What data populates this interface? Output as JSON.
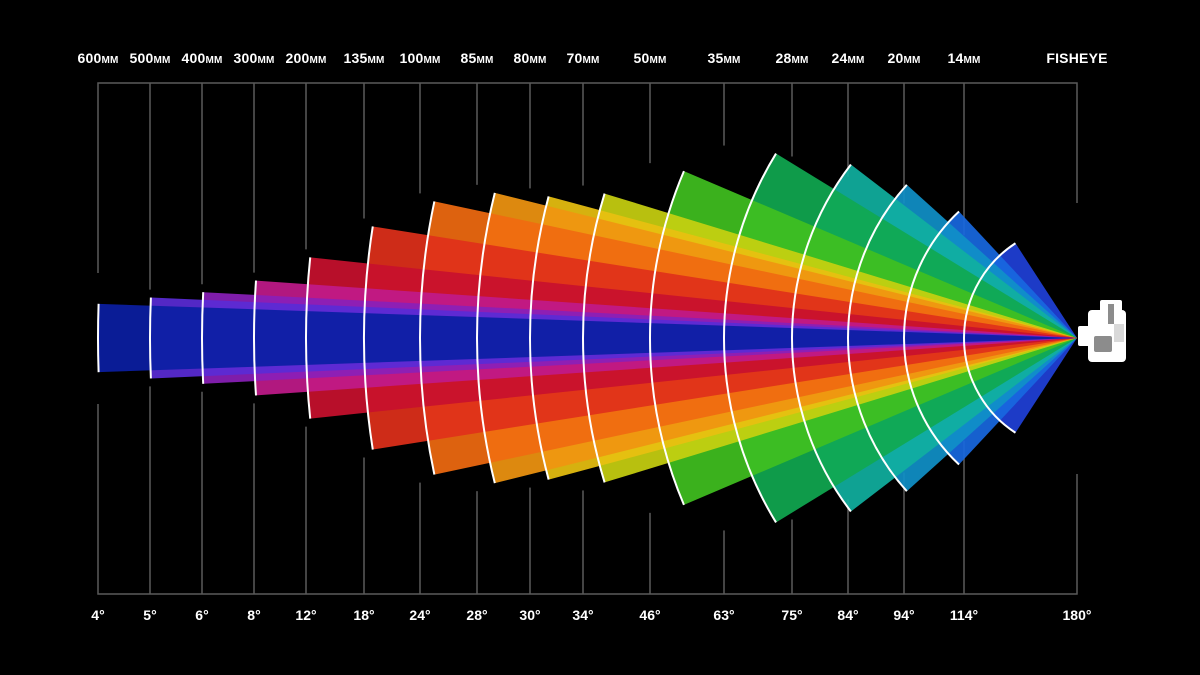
{
  "columns": [
    {
      "focal": "600",
      "unit": "MM",
      "angle": "4°",
      "deg": 4,
      "color": "#0b1ea3"
    },
    {
      "focal": "500",
      "unit": "MM",
      "angle": "5°",
      "deg": 5,
      "color": "#5a2bd6"
    },
    {
      "focal": "400",
      "unit": "MM",
      "angle": "6°",
      "deg": 6,
      "color": "#8a1fb8"
    },
    {
      "focal": "300",
      "unit": "MM",
      "angle": "8°",
      "deg": 8,
      "color": "#c01a8a"
    },
    {
      "focal": "200",
      "unit": "MM",
      "angle": "12°",
      "deg": 12,
      "color": "#c8102e"
    },
    {
      "focal": "135",
      "unit": "MM",
      "angle": "18°",
      "deg": 18,
      "color": "#e0301a"
    },
    {
      "focal": "100",
      "unit": "MM",
      "angle": "24°",
      "deg": 24,
      "color": "#f06a10"
    },
    {
      "focal": "85",
      "unit": "MM",
      "angle": "28°",
      "deg": 28,
      "color": "#f09510"
    },
    {
      "focal": "80",
      "unit": "MM",
      "angle": "30°",
      "deg": 30,
      "color": "#e8c010"
    },
    {
      "focal": "70",
      "unit": "MM",
      "angle": "34°",
      "deg": 34,
      "color": "#c8d010"
    },
    {
      "focal": "50",
      "unit": "MM",
      "angle": "46°",
      "deg": 46,
      "color": "#40c020"
    },
    {
      "focal": "35",
      "unit": "MM",
      "angle": "63°",
      "deg": 63,
      "color": "#10a850"
    },
    {
      "focal": "28",
      "unit": "MM",
      "angle": "75°",
      "deg": 75,
      "color": "#10b0a0"
    },
    {
      "focal": "24",
      "unit": "MM",
      "angle": "84°",
      "deg": 84,
      "color": "#1090c8"
    },
    {
      "focal": "20",
      "unit": "MM",
      "angle": "94°",
      "deg": 94,
      "color": "#1868e0"
    },
    {
      "focal": "14",
      "unit": "MM",
      "angle": "114°",
      "deg": 114,
      "color": "#2040d8"
    },
    {
      "focal": "FISHEYE",
      "unit": "",
      "angle": "180°",
      "deg": 180,
      "color": "#0a1f9c"
    }
  ],
  "icons": {
    "camera": "camera-icon"
  }
}
